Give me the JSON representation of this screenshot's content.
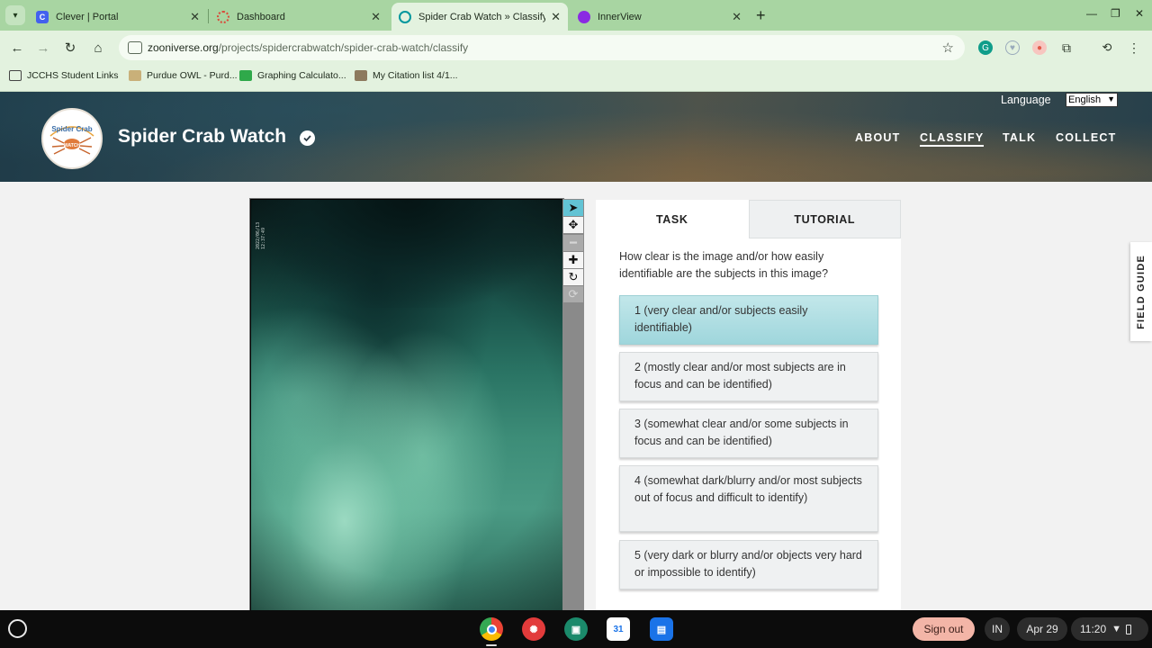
{
  "browser": {
    "tabs": [
      {
        "title": "Clever | Portal",
        "favicon_color": "#4361ee",
        "favicon_glyph": "C"
      },
      {
        "title": "Dashboard",
        "favicon_color": "#d94a3a",
        "favicon_glyph": ""
      },
      {
        "title": "Spider Crab Watch » Classify –",
        "favicon_color": "#00979d",
        "favicon_glyph": ""
      },
      {
        "title": "InnerView",
        "favicon_color": "#8a2be2",
        "favicon_glyph": ""
      }
    ],
    "url_host": "zooniverse.org",
    "url_path": "/projects/spidercrabwatch/spider-crab-watch/classify",
    "bookmarks": [
      {
        "label": "JCCHS Student Links",
        "icon": "folder-icon"
      },
      {
        "label": "Purdue OWL - Purd...",
        "icon": "purdue-icon"
      },
      {
        "label": "Graphing Calculato...",
        "icon": "desmos-icon"
      },
      {
        "label": "My Citation list 4/1...",
        "icon": "citation-icon"
      }
    ]
  },
  "header": {
    "project_title": "Spider Crab Watch",
    "logo_text_top": "Spider Crab",
    "logo_text_bottom": "WATCH",
    "language_label": "Language",
    "language_value": "English",
    "nav": [
      {
        "label": "ABOUT",
        "active": false
      },
      {
        "label": "CLASSIFY",
        "active": true
      },
      {
        "label": "TALK",
        "active": false
      },
      {
        "label": "COLLECT",
        "active": false
      }
    ]
  },
  "subject": {
    "timestamp": "2022/06/13 12:37:49"
  },
  "tools": [
    "pointer-icon",
    "pan-icon",
    "zoom-out-icon",
    "zoom-in-icon",
    "rotate-icon",
    "reset-icon"
  ],
  "task": {
    "tabs": [
      "TASK",
      "TUTORIAL"
    ],
    "question": "How clear is the image and/or how easily identifiable are the subjects in this image?",
    "answers": [
      {
        "label": "1 (very clear and/or subjects easily identifiable)",
        "selected": true
      },
      {
        "label": "2 (mostly clear and/or most subjects are in focus and can be identified)",
        "selected": false
      },
      {
        "label": "3 (somewhat clear and/or some subjects in focus and can be identified)",
        "selected": false
      },
      {
        "label": "4 (somewhat dark/blurry and/or most subjects out of focus and difficult to identify)",
        "selected": false
      },
      {
        "label": "5 (very dark or blurry and/or objects very hard or impossible to identify)",
        "selected": false
      }
    ]
  },
  "field_guide_label": "FIELD GUIDE",
  "shelf": {
    "signout_label": "Sign out",
    "ime_label": "IN",
    "date_label": "Apr 29",
    "time_label": "11:20",
    "apps": [
      "chrome-icon",
      "canvas-icon",
      "classroom-icon",
      "calendar-icon",
      "files-icon"
    ],
    "calendar_day": "31"
  },
  "colors": {
    "chrome_tabstrip": "#a8d5a2",
    "chrome_toolbar": "#e3f2df",
    "selected_answer": "#9fd6dc",
    "active_tool": "#62c3d4",
    "signout": "#f3b5a7"
  }
}
